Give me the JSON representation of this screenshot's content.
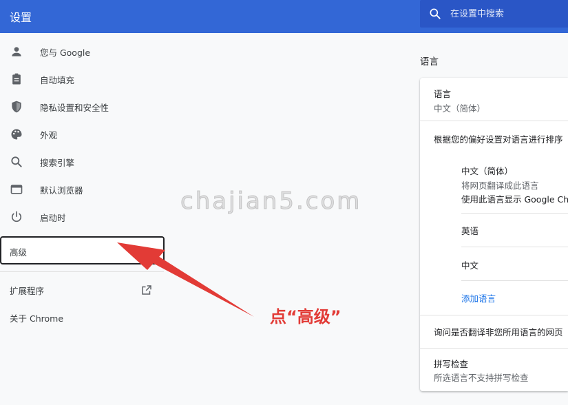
{
  "header": {
    "title": "设置",
    "search_placeholder": "在设置中搜索"
  },
  "sidebar": {
    "items": [
      {
        "label": "您与 Google",
        "icon": "person-icon"
      },
      {
        "label": "自动填充",
        "icon": "clipboard-icon"
      },
      {
        "label": "隐私设置和安全性",
        "icon": "shield-icon"
      },
      {
        "label": "外观",
        "icon": "palette-icon"
      },
      {
        "label": "搜索引擎",
        "icon": "search-icon"
      },
      {
        "label": "默认浏览器",
        "icon": "browser-icon"
      },
      {
        "label": "启动时",
        "icon": "power-icon"
      }
    ],
    "advanced_label": "高级",
    "extensions_label": "扩展程序",
    "about_label": "关于 Chrome"
  },
  "language_section": {
    "title": "语言",
    "language_label": "语言",
    "language_value": "中文（简体）",
    "order_hint": "根据您的偏好设置对语言进行排序",
    "languages": [
      {
        "name": "中文（简体）",
        "translate_line": "将网页翻译成此语言",
        "display_line": "使用此语言显示 Google Chrome"
      },
      {
        "name": "英语"
      },
      {
        "name": "中文"
      }
    ],
    "add_language": "添加语言",
    "translate_offer": "询问是否翻译非您所用语言的网页",
    "spellcheck_label": "拼写检查",
    "spellcheck_value": "所选语言不支持拼写检查"
  },
  "overlay": {
    "watermark": "chajian5.com",
    "annotation": "点“高级”",
    "arrow_color": "#e23b36"
  },
  "colors": {
    "header_bg": "#3367d6",
    "search_bg": "#2a56c6",
    "link": "#1a73e8"
  }
}
